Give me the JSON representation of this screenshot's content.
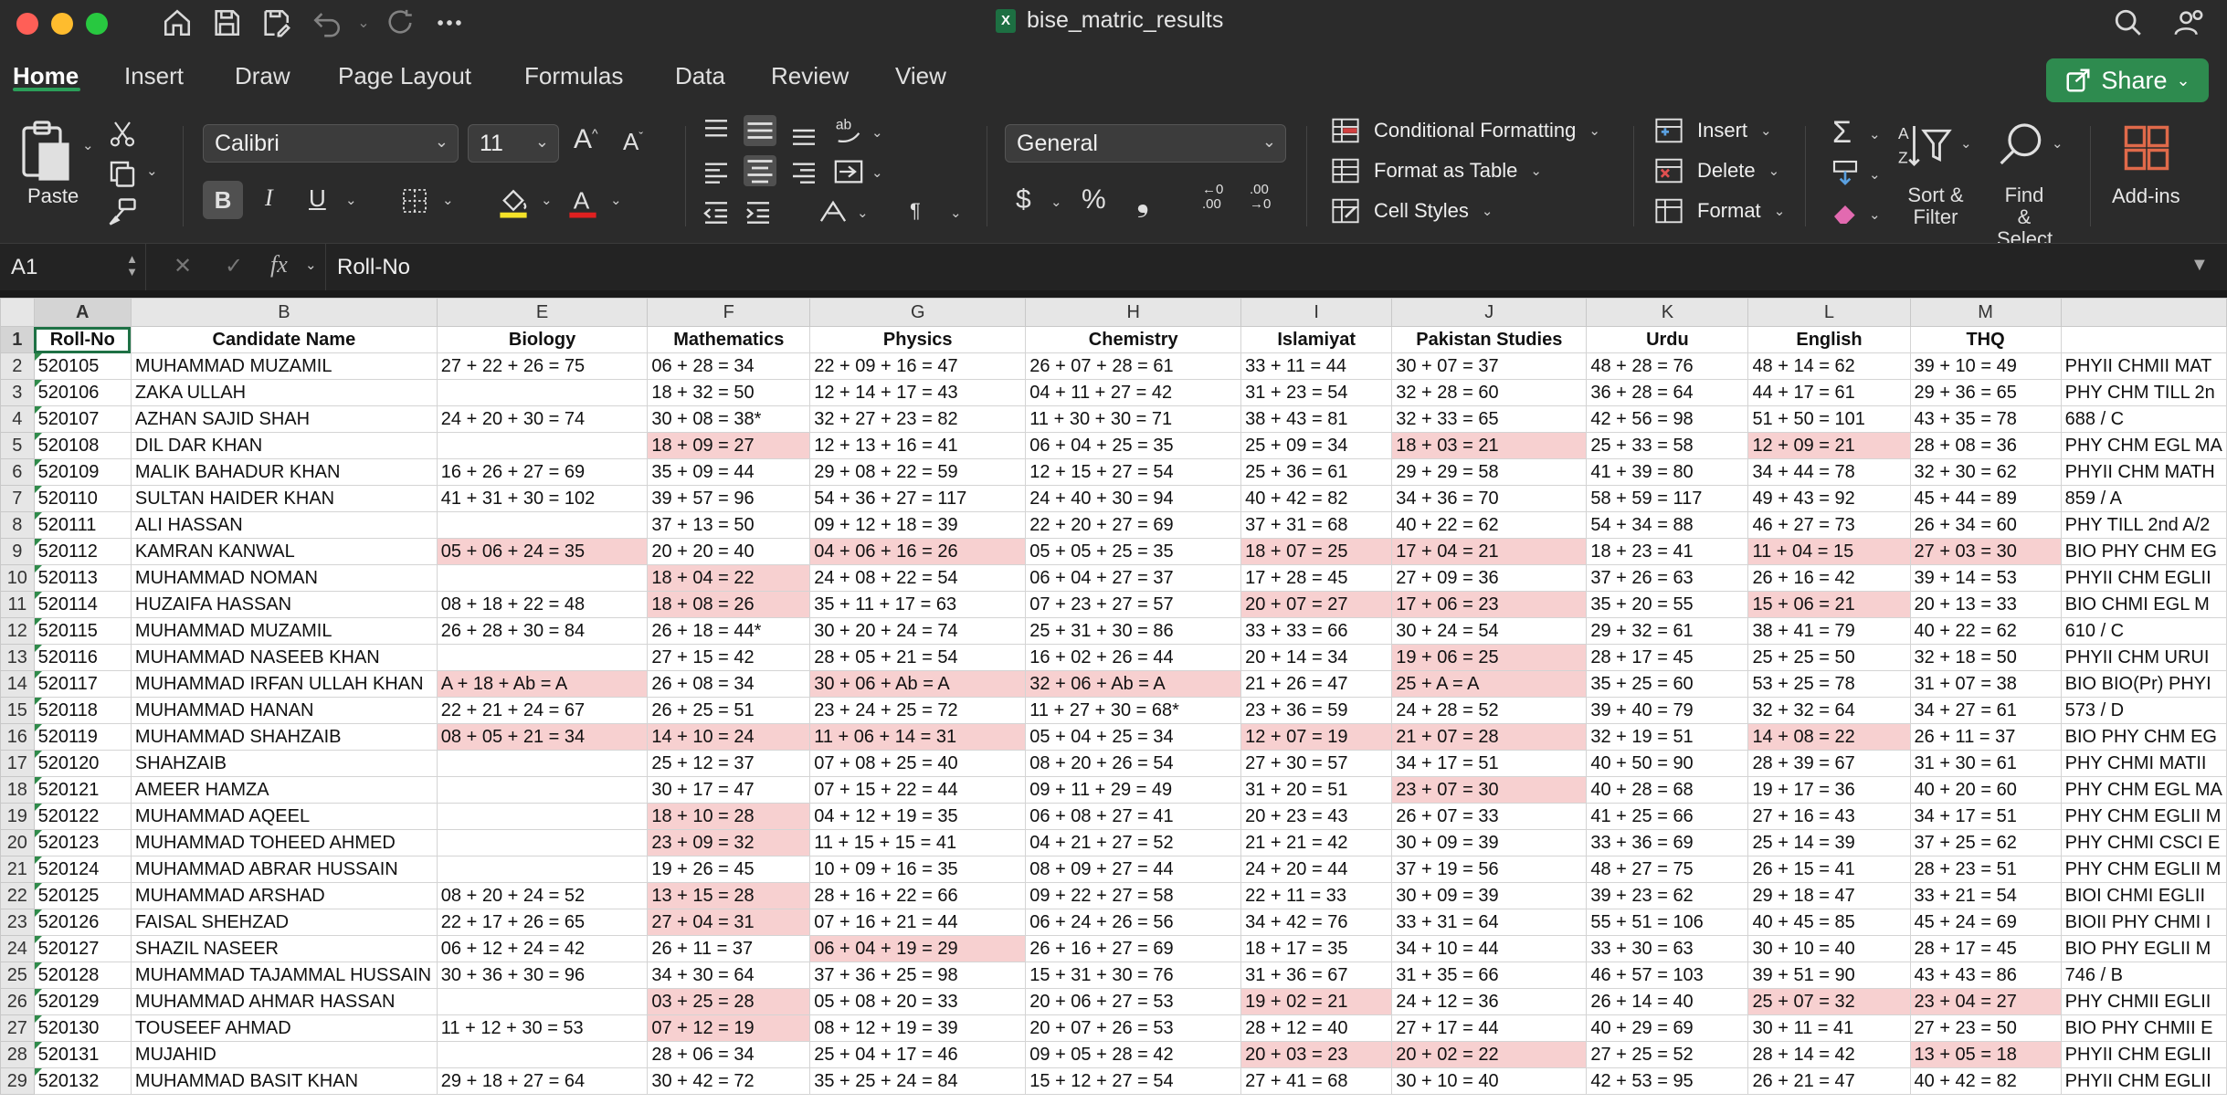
{
  "window": {
    "title": "bise_matric_results",
    "traffic_colors": [
      "#ff5f57",
      "#febc2e",
      "#28c840"
    ]
  },
  "tabs": [
    "Home",
    "Insert",
    "Draw",
    "Page Layout",
    "Formulas",
    "Data",
    "Review",
    "View"
  ],
  "share_label": "Share",
  "ribbon": {
    "paste_label": "Paste",
    "font_name": "Calibri",
    "font_size": "11",
    "number_format": "General",
    "conditional_formatting": "Conditional Formatting",
    "format_as_table": "Format as Table",
    "cell_styles": "Cell Styles",
    "insert": "Insert",
    "delete": "Delete",
    "format": "Format",
    "sort_filter": "Sort & Filter",
    "find_select": "Find & Select",
    "addins": "Add-ins"
  },
  "formula_bar": {
    "cell_ref": "A1",
    "fx": "fx",
    "content": "Roll-No"
  },
  "sheet": {
    "columns": [
      "A",
      "B",
      "E",
      "F",
      "G",
      "H",
      "I",
      "J",
      "K",
      "L",
      "M",
      ""
    ],
    "header_row": [
      "Roll-No",
      "Candidate Name",
      "Biology",
      "Mathematics",
      "Physics",
      "Chemistry",
      "Islamiyat",
      "Pakistan Studies",
      "Urdu",
      "English",
      "THQ",
      ""
    ],
    "rows": [
      [
        "520105",
        "MUHAMMAD MUZAMIL",
        "27 + 22 + 26 = 75",
        "06 + 28 = 34",
        "22 + 09 + 16 = 47",
        "26 + 07 + 28 = 61",
        "33 + 11 = 44",
        "30 + 07 = 37",
        "48 + 28 = 76",
        "48 + 14 = 62",
        "39 + 10 = 49",
        "PHYII CHMII MAT"
      ],
      [
        "520106",
        "ZAKA ULLAH",
        "",
        "18 + 32 = 50",
        "12 + 14 + 17 = 43",
        "04 + 11 + 27 = 42",
        "31 + 23 = 54",
        "32 + 28 = 60",
        "36 + 28 = 64",
        "44 + 17 = 61",
        "29 + 36 = 65",
        "PHY CHM TILL 2n"
      ],
      [
        "520107",
        "AZHAN SAJID SHAH",
        "24 + 20 + 30 = 74",
        "30 + 08 = 38*",
        "32 + 27 + 23 = 82",
        "11 + 30 + 30 = 71",
        "38 + 43 = 81",
        "32 + 33 = 65",
        "42 + 56 = 98",
        "51 + 50 = 101",
        "43 + 35 = 78",
        "688 / C"
      ],
      [
        "520108",
        "DIL DAR KHAN",
        "",
        "18 + 09 = 27",
        "12 + 13 + 16 = 41",
        "06 + 04 + 25 = 35",
        "25 + 09 = 34",
        "18 + 03 = 21",
        "25 + 33 = 58",
        "12 + 09 = 21",
        "28 + 08 = 36",
        "PHY CHM EGL MA"
      ],
      [
        "520109",
        "MALIK BAHADUR KHAN",
        "16 + 26 + 27 = 69",
        "35 + 09 = 44",
        "29 + 08 + 22 = 59",
        "12 + 15 + 27 = 54",
        "25 + 36 = 61",
        "29 + 29 = 58",
        "41 + 39 = 80",
        "34 + 44 = 78",
        "32 + 30 = 62",
        "PHYII CHM MATH"
      ],
      [
        "520110",
        "SULTAN HAIDER KHAN",
        "41 + 31 + 30 = 102",
        "39 + 57 = 96",
        "54 + 36 + 27 = 117",
        "24 + 40 + 30 = 94",
        "40 + 42 = 82",
        "34 + 36 = 70",
        "58 + 59 = 117",
        "49 + 43 = 92",
        "45 + 44 = 89",
        "859 / A"
      ],
      [
        "520111",
        "ALI HASSAN",
        "",
        "37 + 13 = 50",
        "09 + 12 + 18 = 39",
        "22 + 20 + 27 = 69",
        "37 + 31 = 68",
        "40 + 22 = 62",
        "54 + 34 = 88",
        "46 + 27 = 73",
        "26 + 34 = 60",
        "PHY TILL 2nd A/2"
      ],
      [
        "520112",
        "KAMRAN KANWAL",
        "05 + 06 + 24 = 35",
        "20 + 20 = 40",
        "04 + 06 + 16 = 26",
        "05 + 05 + 25 = 35",
        "18 + 07 = 25",
        "17 + 04 = 21",
        "18 + 23 = 41",
        "11 + 04 = 15",
        "27 + 03 = 30",
        "BIO PHY CHM EG"
      ],
      [
        "520113",
        "MUHAMMAD NOMAN",
        "",
        "18 + 04 = 22",
        "24 + 08 + 22 = 54",
        "06 + 04 + 27 = 37",
        "17 + 28 = 45",
        "27 + 09 = 36",
        "37 + 26 = 63",
        "26 + 16 = 42",
        "39 + 14 = 53",
        "PHYII CHM EGLII"
      ],
      [
        "520114",
        "HUZAIFA HASSAN",
        "08 + 18 + 22 = 48",
        "18 + 08 = 26",
        "35 + 11 + 17 = 63",
        "07 + 23 + 27 = 57",
        "20 + 07 = 27",
        "17 + 06 = 23",
        "35 + 20 = 55",
        "15 + 06 = 21",
        "20 + 13 = 33",
        "BIO CHMI EGL M"
      ],
      [
        "520115",
        "MUHAMMAD MUZAMIL",
        "26 + 28 + 30 = 84",
        "26 + 18 = 44*",
        "30 + 20 + 24 = 74",
        "25 + 31 + 30 = 86",
        "33 + 33 = 66",
        "30 + 24 = 54",
        "29 + 32 = 61",
        "38 + 41 = 79",
        "40 + 22 = 62",
        "610 / C"
      ],
      [
        "520116",
        "MUHAMMAD NASEEB KHAN",
        "",
        "27 + 15 = 42",
        "28 + 05 + 21 = 54",
        "16 + 02 + 26 = 44",
        "20 + 14 = 34",
        "19 + 06 = 25",
        "28 + 17 = 45",
        "25 + 25 = 50",
        "32 + 18 = 50",
        "PHYII CHM URUI"
      ],
      [
        "520117",
        "MUHAMMAD IRFAN ULLAH KHAN",
        "A + 18 + Ab = A",
        "26 + 08 = 34",
        "30 + 06 + Ab = A",
        "32 + 06 + Ab = A",
        "21 + 26 = 47",
        "25 + A = A",
        "35 + 25 = 60",
        "53 + 25 = 78",
        "31 + 07 = 38",
        "BIO BIO(Pr) PHYI"
      ],
      [
        "520118",
        "MUHAMMAD HANAN",
        "22 + 21 + 24 = 67",
        "26 + 25 = 51",
        "23 + 24 + 25 = 72",
        "11 + 27 + 30 = 68*",
        "23 + 36 = 59",
        "24 + 28 = 52",
        "39 + 40 = 79",
        "32 + 32 = 64",
        "34 + 27 = 61",
        "573 / D"
      ],
      [
        "520119",
        "MUHAMMAD SHAHZAIB",
        "08 + 05 + 21 = 34",
        "14 + 10 = 24",
        "11 + 06 + 14 = 31",
        "05 + 04 + 25 = 34",
        "12 + 07 = 19",
        "21 + 07 = 28",
        "32 + 19 = 51",
        "14 + 08 = 22",
        "26 + 11 = 37",
        "BIO PHY CHM EG"
      ],
      [
        "520120",
        "SHAHZAIB",
        "",
        "25 + 12 = 37",
        "07 + 08 + 25 = 40",
        "08 + 20 + 26 = 54",
        "27 + 30 = 57",
        "34 + 17 = 51",
        "40 + 50 = 90",
        "28 + 39 = 67",
        "31 + 30 = 61",
        "PHY CHMI MATII"
      ],
      [
        "520121",
        "AMEER HAMZA",
        "",
        "30 + 17 = 47",
        "07 + 15 + 22 = 44",
        "09 + 11 + 29 = 49",
        "31 + 20 = 51",
        "23 + 07 = 30",
        "40 + 28 = 68",
        "19 + 17 = 36",
        "40 + 20 = 60",
        "PHY CHM EGL MA"
      ],
      [
        "520122",
        "MUHAMMAD AQEEL",
        "",
        "18 + 10 = 28",
        "04 + 12 + 19 = 35",
        "06 + 08 + 27 = 41",
        "20 + 23 = 43",
        "26 + 07 = 33",
        "41 + 25 = 66",
        "27 + 16 = 43",
        "34 + 17 = 51",
        "PHY CHM EGLII M"
      ],
      [
        "520123",
        "MUHAMMAD TOHEED AHMED",
        "",
        "23 + 09 = 32",
        "11 + 15 + 15 = 41",
        "04 + 21 + 27 = 52",
        "21 + 21 = 42",
        "30 + 09 = 39",
        "33 + 36 = 69",
        "25 + 14 = 39",
        "37 + 25 = 62",
        "PHY CHMI CSCI E"
      ],
      [
        "520124",
        "MUHAMMAD ABRAR HUSSAIN",
        "",
        "19 + 26 = 45",
        "10 + 09 + 16 = 35",
        "08 + 09 + 27 = 44",
        "24 + 20 = 44",
        "37 + 19 = 56",
        "48 + 27 = 75",
        "26 + 15 = 41",
        "28 + 23 = 51",
        "PHY CHM EGLII M"
      ],
      [
        "520125",
        "MUHAMMAD ARSHAD",
        "08 + 20 + 24 = 52",
        "13 + 15 = 28",
        "28 + 16 + 22 = 66",
        "09 + 22 + 27 = 58",
        "22 + 11 = 33",
        "30 + 09 = 39",
        "39 + 23 = 62",
        "29 + 18 = 47",
        "33 + 21 = 54",
        "BIOI CHMI EGLII"
      ],
      [
        "520126",
        "FAISAL SHEHZAD",
        "22 + 17 + 26 = 65",
        "27 + 04 = 31",
        "07 + 16 + 21 = 44",
        "06 + 24 + 26 = 56",
        "34 + 42 = 76",
        "33 + 31 = 64",
        "55 + 51 = 106",
        "40 + 45 = 85",
        "45 + 24 = 69",
        "BIOII PHY CHMI I"
      ],
      [
        "520127",
        "SHAZIL NASEER",
        "06 + 12 + 24 = 42",
        "26 + 11 = 37",
        "06 + 04 + 19 = 29",
        "26 + 16 + 27 = 69",
        "18 + 17 = 35",
        "34 + 10 = 44",
        "33 + 30 = 63",
        "30 + 10 = 40",
        "28 + 17 = 45",
        "BIO PHY EGLII M"
      ],
      [
        "520128",
        "MUHAMMAD TAJAMMAL HUSSAIN",
        "30 + 36 + 30 = 96",
        "34 + 30 = 64",
        "37 + 36 + 25 = 98",
        "15 + 31 + 30 = 76",
        "31 + 36 = 67",
        "31 + 35 = 66",
        "46 + 57 = 103",
        "39 + 51 = 90",
        "43 + 43 = 86",
        "746 / B"
      ],
      [
        "520129",
        "MUHAMMAD AHMAR HASSAN",
        "",
        "03 + 25 = 28",
        "05 + 08 + 20 = 33",
        "20 + 06 + 27 = 53",
        "19 + 02 = 21",
        "24 + 12 = 36",
        "26 + 14 = 40",
        "25 + 07 = 32",
        "23 + 04 = 27",
        "PHY CHMII EGLII"
      ],
      [
        "520130",
        "TOUSEEF AHMAD",
        "11 + 12 + 30 = 53",
        "07 + 12 = 19",
        "08 + 12 + 19 = 39",
        "20 + 07 + 26 = 53",
        "28 + 12 = 40",
        "27 + 17 = 44",
        "40 + 29 = 69",
        "30 + 11 = 41",
        "27 + 23 = 50",
        "BIO PHY CHMII E"
      ],
      [
        "520131",
        "MUJAHID",
        "",
        "28 + 06 = 34",
        "25 + 04 + 17 = 46",
        "09 + 05 + 28 = 42",
        "20 + 03 = 23",
        "20 + 02 = 22",
        "27 + 25 = 52",
        "28 + 14 = 42",
        "13 + 05 = 18",
        "PHYII CHM EGLII"
      ],
      [
        "520132",
        "MUHAMMAD BASIT KHAN",
        "29 + 18 + 27 = 64",
        "30 + 42 = 72",
        "35 + 25 + 24 = 84",
        "15 + 12 + 27 = 54",
        "27 + 41 = 68",
        "30 + 10 = 40",
        "42 + 53 = 95",
        "26 + 21 = 47",
        "40 + 42 = 82",
        "PHYII CHM EGLII"
      ]
    ],
    "highlight_color": "#f7d0d0"
  }
}
